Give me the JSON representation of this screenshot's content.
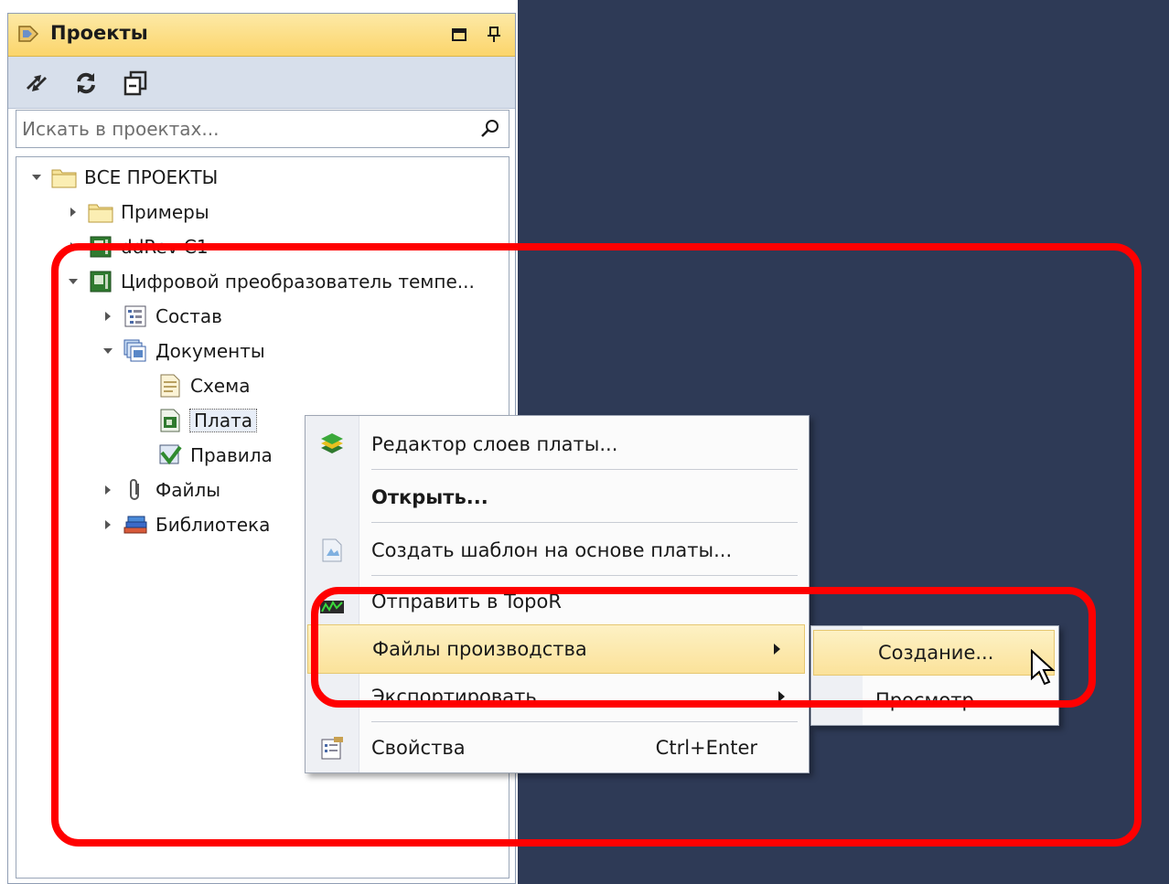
{
  "panel": {
    "title": "Проекты",
    "search_placeholder": "Искать в проектах..."
  },
  "tree": [
    {
      "label": "ВСЕ ПРОЕКТЫ",
      "icon": "folder-icon",
      "expanded": true
    },
    {
      "label": "Примеры",
      "icon": "folder-icon",
      "expanded": false
    },
    {
      "label": "ddRev C1",
      "icon": "board-project-icon",
      "expanded": false
    },
    {
      "label": "Цифровой преобразователь темпе...",
      "icon": "board-project-icon",
      "expanded": true
    },
    {
      "label": "Состав",
      "icon": "composition-icon",
      "expanded": false
    },
    {
      "label": "Документы",
      "icon": "documents-icon",
      "expanded": true
    },
    {
      "label": "Схема",
      "icon": "schematic-icon"
    },
    {
      "label": "Плата",
      "icon": "pcb-icon",
      "selected": true
    },
    {
      "label": "Правила",
      "icon": "rules-icon"
    },
    {
      "label": "Файлы",
      "icon": "paperclip-icon",
      "expanded": false
    },
    {
      "label": "Библиотека",
      "icon": "library-icon",
      "expanded": false
    }
  ],
  "context_menu": {
    "items": [
      {
        "label": "Редактор слоев платы...",
        "icon": "layers-icon"
      },
      {
        "label": "Открыть...",
        "bold": true
      },
      {
        "label": "Создать шаблон на основе платы...",
        "icon": "template-icon"
      },
      {
        "label": "Отправить в TopoR",
        "icon": "topor-icon"
      },
      {
        "label": "Файлы производства",
        "submenu": true,
        "highlighted": true
      },
      {
        "label": "Экспортировать",
        "submenu": true
      },
      {
        "label": "Свойства",
        "icon": "properties-icon",
        "shortcut": "Ctrl+Enter"
      }
    ]
  },
  "submenu": {
    "items": [
      {
        "label": "Создание...",
        "highlighted": true
      },
      {
        "label": "Просмотр"
      }
    ]
  },
  "colors": {
    "header": "#fbd56b",
    "highlight": "#fbe29a",
    "annotation": "#ff0000",
    "background_dark": "#2e3a56"
  }
}
